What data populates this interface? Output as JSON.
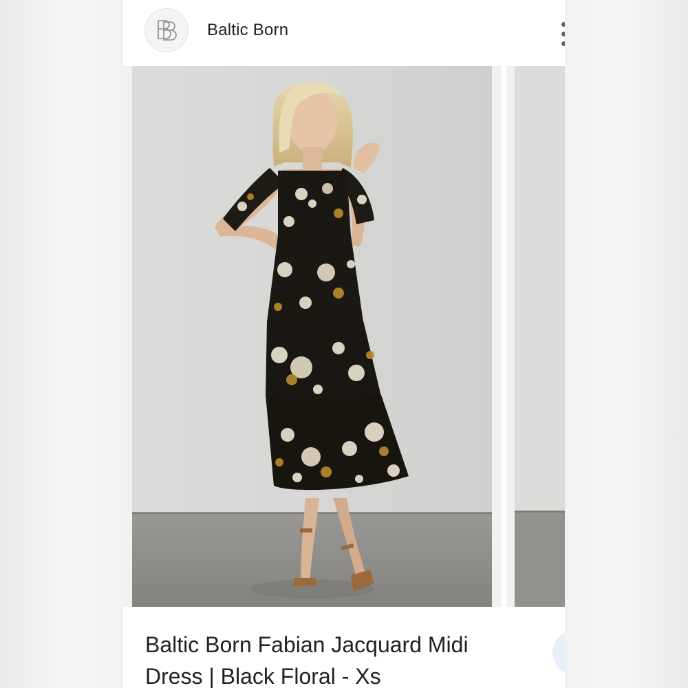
{
  "header": {
    "brand_name": "Baltic Born",
    "logo_icon": "baltic-born-monogram-logo",
    "more_icon": "more-vert-icon"
  },
  "gallery": {
    "main_image": "model-in-black-floral-midi-dress",
    "next_image": "next-product-photo-preview"
  },
  "product": {
    "title_line1": "Baltic Born Fabian Jacquard Midi",
    "title_line2": "Dress | Black Floral - Xs"
  },
  "colors": {
    "dress": "#1a1712",
    "floral_white": "#e9e2cf",
    "floral_gold": "#b58a2c",
    "wall": "#d9d9d7",
    "floor": "#8e8c88"
  }
}
